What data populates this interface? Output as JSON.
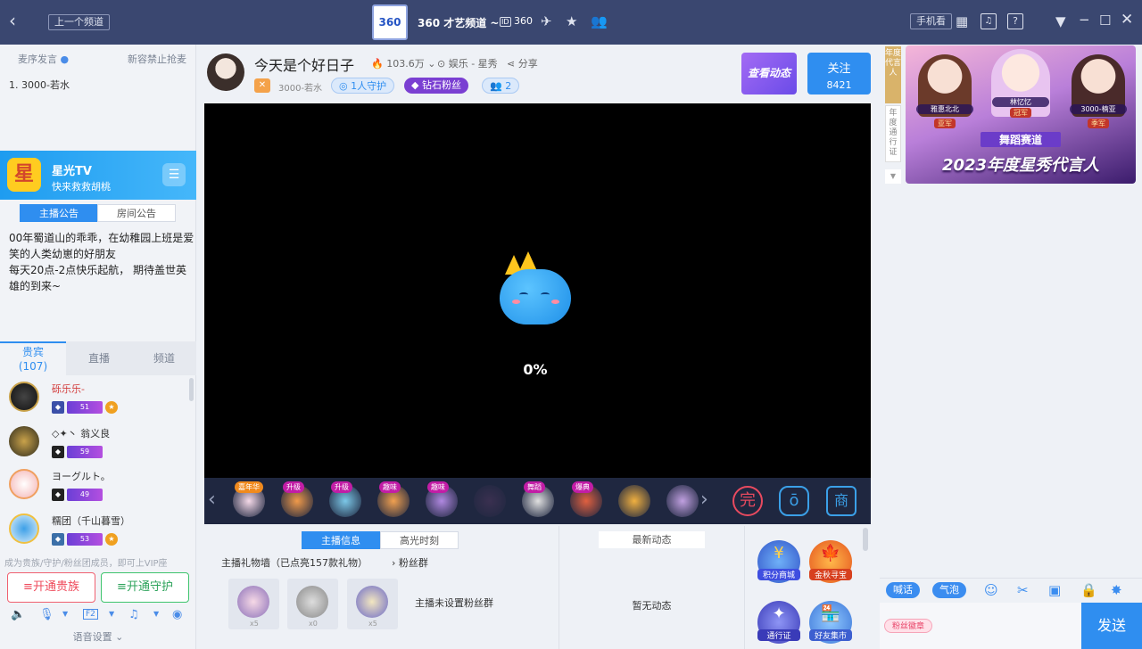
{
  "topbar": {
    "prev_channel": "上一个频道",
    "channel_title": "360 才艺频道 ~",
    "id_label": "ID",
    "id_value": "360",
    "logo_text": "360",
    "phone_watch": "手机看"
  },
  "left": {
    "order_speech": "麦序发言",
    "no_grab": "新容禁止抢麦",
    "queue_item": "1. 3000-若水",
    "ad_title": "星光TV",
    "ad_sub": "快来救救胡桃",
    "ad_icon_char": "星",
    "tabs": [
      "主播公告",
      "房间公告"
    ],
    "announcement": "00年蜀道山的乖乖，在幼稚园上班是爱笑的人类幼崽的好朋友\n每天20点-2点快乐起航， 期待盖世英雄的到来~",
    "vip_tabs": {
      "guests": "贵宾",
      "guests_count": "(107)",
      "live": "直播",
      "channel": "频道"
    },
    "vip_list": [
      {
        "name": "砾乐乐-",
        "level": "51"
      },
      {
        "name": "◇✦丶 翁义良",
        "level": "59"
      },
      {
        "name": "ヨーグルト。",
        "level": "49"
      },
      {
        "name": "糯团（千山暮雪）",
        "level": "53"
      }
    ],
    "join_hint": "成为贵族/守护/粉丝团成员，即可上VIP座",
    "btn_noble": "开通贵族",
    "btn_guard": "开通守护",
    "voice_settings": "语音设置"
  },
  "anchor": {
    "title": "今天是个好日子",
    "heat": "103.6万",
    "category": "娱乐 - 星秀",
    "share": "分享",
    "name": "3000-若水",
    "guard": "1人守护",
    "fans": "钻石粉丝",
    "fans_count": "2",
    "view_dynamic": "查看动态",
    "follow": "关注",
    "follow_count": "8421"
  },
  "video": {
    "loading": "0%"
  },
  "gifts": [
    {
      "tag": "嘉年华"
    },
    {
      "tag": "升级"
    },
    {
      "tag": "升级"
    },
    {
      "tag": "趣味"
    },
    {
      "tag": "趣味"
    },
    {
      "tag": ""
    },
    {
      "tag": "舞蹈"
    },
    {
      "tag": "爆典"
    },
    {
      "tag": ""
    },
    {
      "tag": ""
    }
  ],
  "gift_icons": {
    "wan": "完",
    "bag": "ō",
    "shop": "商"
  },
  "bottom": {
    "tab_info": "主播信息",
    "tab_highlight": "高光时刻",
    "gift_wall": "主播礼物墙（已点亮157款礼物）",
    "fan_group": "粉丝群",
    "fan_group_empty": "主播未设置粉丝群",
    "gift_counts": [
      "x5",
      "x0",
      "x5"
    ],
    "latest": "最新动态",
    "no_dynamic": "暂无动态",
    "apps": [
      "积分商城",
      "金秋寻宝",
      "通行证",
      "好友集市"
    ]
  },
  "right": {
    "side_tab1": "年度代言人",
    "side_tab2": "年度通行证",
    "banner_title": "2023年度星秀代言人",
    "banner_sub": "舞蹈赛道",
    "banner_names": [
      "雅惠北北",
      "林忆忆",
      "3000-楠亚"
    ],
    "banner_ranks": [
      "亚军",
      "冠军",
      "季军"
    ],
    "chat_btn1": "喊话",
    "chat_btn2": "气泡",
    "fans_badge": "粉丝徽章",
    "send": "发送"
  }
}
